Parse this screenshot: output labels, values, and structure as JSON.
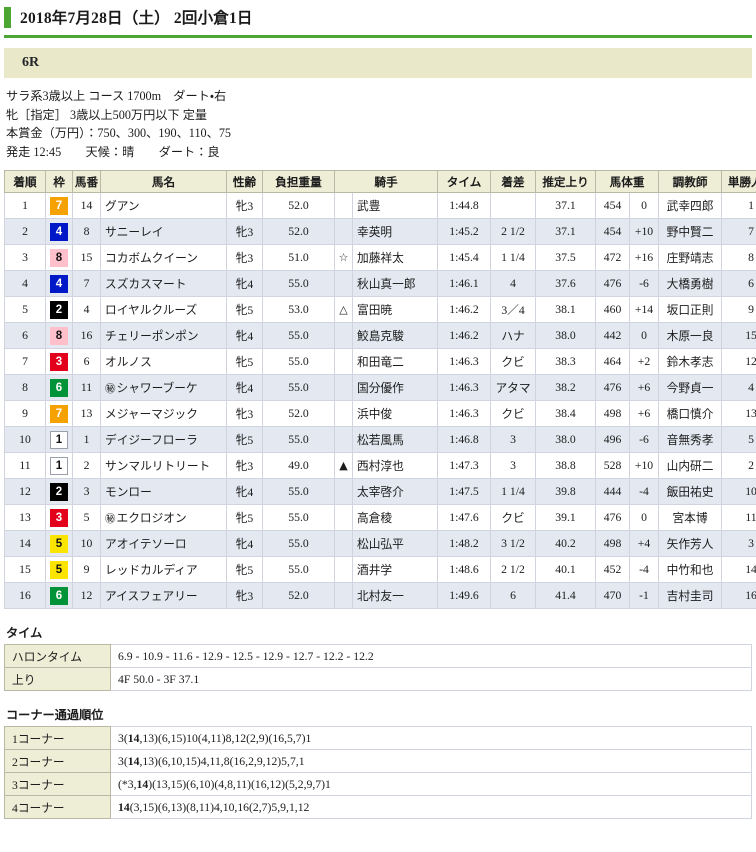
{
  "header": {
    "date_title": "2018年7月28日（土） 2回小倉1日",
    "accent_color": "#4ca632"
  },
  "race": {
    "number_label": "6R",
    "banner_color": "#e9e8c8",
    "conditions": [
      "サラ系3歳以上 コース 1700m　ダート・右",
      "牝［指定］ 3歳以上500万円以下 定量",
      "本賞金（万円）：750、300、190、110、75",
      "発走 12:45　　天候：晴　　ダート：良"
    ]
  },
  "result_table": {
    "columns": [
      "着順",
      "枠",
      "馬番",
      "馬名",
      "性齢",
      "負担重量",
      "騎手",
      "タイム",
      "着差",
      "推定上り",
      "馬体重",
      "調教師",
      "単勝人気"
    ],
    "rows": [
      {
        "rank": "1",
        "waku": "7",
        "umaban": "14",
        "local_mark": "",
        "horse": "グアン",
        "sex_age": "牝3",
        "weight": "52.0",
        "jockey_mark": "",
        "jockey": "武豊",
        "time": "1:44.8",
        "margin": "",
        "last3f": "37.1",
        "body_weight": "454",
        "body_diff": "0",
        "trainer": "武幸四郎",
        "popularity": "1"
      },
      {
        "rank": "2",
        "waku": "4",
        "umaban": "8",
        "local_mark": "",
        "horse": "サニーレイ",
        "sex_age": "牝3",
        "weight": "52.0",
        "jockey_mark": "",
        "jockey": "幸英明",
        "time": "1:45.2",
        "margin": "2 1/2",
        "last3f": "37.1",
        "body_weight": "454",
        "body_diff": "+10",
        "trainer": "野中賢二",
        "popularity": "7"
      },
      {
        "rank": "3",
        "waku": "8",
        "umaban": "15",
        "local_mark": "",
        "horse": "コカボムクイーン",
        "sex_age": "牝3",
        "weight": "51.0",
        "jockey_mark": "☆",
        "jockey": "加藤祥太",
        "time": "1:45.4",
        "margin": "1 1/4",
        "last3f": "37.5",
        "body_weight": "472",
        "body_diff": "+16",
        "trainer": "庄野靖志",
        "popularity": "8"
      },
      {
        "rank": "4",
        "waku": "4",
        "umaban": "7",
        "local_mark": "",
        "horse": "スズカスマート",
        "sex_age": "牝4",
        "weight": "55.0",
        "jockey_mark": "",
        "jockey": "秋山真一郎",
        "time": "1:46.1",
        "margin": "4",
        "last3f": "37.6",
        "body_weight": "476",
        "body_diff": "-6",
        "trainer": "大橋勇樹",
        "popularity": "6"
      },
      {
        "rank": "5",
        "waku": "2",
        "umaban": "4",
        "local_mark": "",
        "horse": "ロイヤルクルーズ",
        "sex_age": "牝5",
        "weight": "53.0",
        "jockey_mark": "△",
        "jockey": "富田暁",
        "time": "1:46.2",
        "margin": "3／4",
        "last3f": "38.1",
        "body_weight": "460",
        "body_diff": "+14",
        "trainer": "坂口正則",
        "popularity": "9"
      },
      {
        "rank": "6",
        "waku": "8",
        "umaban": "16",
        "local_mark": "",
        "horse": "チェリーポンポン",
        "sex_age": "牝4",
        "weight": "55.0",
        "jockey_mark": "",
        "jockey": "鮫島克駿",
        "time": "1:46.2",
        "margin": "ハナ",
        "last3f": "38.0",
        "body_weight": "442",
        "body_diff": "0",
        "trainer": "木原一良",
        "popularity": "15"
      },
      {
        "rank": "7",
        "waku": "3",
        "umaban": "6",
        "local_mark": "",
        "horse": "オルノス",
        "sex_age": "牝5",
        "weight": "55.0",
        "jockey_mark": "",
        "jockey": "和田竜二",
        "time": "1:46.3",
        "margin": "クビ",
        "last3f": "38.3",
        "body_weight": "464",
        "body_diff": "+2",
        "trainer": "鈴木孝志",
        "popularity": "12"
      },
      {
        "rank": "8",
        "waku": "6",
        "umaban": "11",
        "local_mark": "地",
        "horse": "シャワーブーケ",
        "sex_age": "牝4",
        "weight": "55.0",
        "jockey_mark": "",
        "jockey": "国分優作",
        "time": "1:46.3",
        "margin": "アタマ",
        "last3f": "38.2",
        "body_weight": "476",
        "body_diff": "+6",
        "trainer": "今野貞一",
        "popularity": "4"
      },
      {
        "rank": "9",
        "waku": "7",
        "umaban": "13",
        "local_mark": "",
        "horse": "メジャーマジック",
        "sex_age": "牝3",
        "weight": "52.0",
        "jockey_mark": "",
        "jockey": "浜中俊",
        "time": "1:46.3",
        "margin": "クビ",
        "last3f": "38.4",
        "body_weight": "498",
        "body_diff": "+6",
        "trainer": "橋口慎介",
        "popularity": "13"
      },
      {
        "rank": "10",
        "waku": "1",
        "umaban": "1",
        "local_mark": "",
        "horse": "デイジーフローラ",
        "sex_age": "牝5",
        "weight": "55.0",
        "jockey_mark": "",
        "jockey": "松若風馬",
        "time": "1:46.8",
        "margin": "3",
        "last3f": "38.0",
        "body_weight": "496",
        "body_diff": "-6",
        "trainer": "音無秀孝",
        "popularity": "5"
      },
      {
        "rank": "11",
        "waku": "1",
        "umaban": "2",
        "local_mark": "",
        "horse": "サンマルリトリート",
        "sex_age": "牝3",
        "weight": "49.0",
        "jockey_mark": "▲",
        "jockey": "西村淳也",
        "time": "1:47.3",
        "margin": "3",
        "last3f": "38.8",
        "body_weight": "528",
        "body_diff": "+10",
        "trainer": "山内研二",
        "popularity": "2"
      },
      {
        "rank": "12",
        "waku": "2",
        "umaban": "3",
        "local_mark": "",
        "horse": "モンロー",
        "sex_age": "牝4",
        "weight": "55.0",
        "jockey_mark": "",
        "jockey": "太宰啓介",
        "time": "1:47.5",
        "margin": "1 1/4",
        "last3f": "39.8",
        "body_weight": "444",
        "body_diff": "-4",
        "trainer": "飯田祐史",
        "popularity": "10"
      },
      {
        "rank": "13",
        "waku": "3",
        "umaban": "5",
        "local_mark": "地",
        "horse": "エクロジオン",
        "sex_age": "牝5",
        "weight": "55.0",
        "jockey_mark": "",
        "jockey": "高倉稜",
        "time": "1:47.6",
        "margin": "クビ",
        "last3f": "39.1",
        "body_weight": "476",
        "body_diff": "0",
        "trainer": "宮本博",
        "popularity": "11"
      },
      {
        "rank": "14",
        "waku": "5",
        "umaban": "10",
        "local_mark": "",
        "horse": "アオイテソーロ",
        "sex_age": "牝4",
        "weight": "55.0",
        "jockey_mark": "",
        "jockey": "松山弘平",
        "time": "1:48.2",
        "margin": "3 1/2",
        "last3f": "40.2",
        "body_weight": "498",
        "body_diff": "+4",
        "trainer": "矢作芳人",
        "popularity": "3"
      },
      {
        "rank": "15",
        "waku": "5",
        "umaban": "9",
        "local_mark": "",
        "horse": "レッドカルディア",
        "sex_age": "牝5",
        "weight": "55.0",
        "jockey_mark": "",
        "jockey": "酒井学",
        "time": "1:48.6",
        "margin": "2 1/2",
        "last3f": "40.1",
        "body_weight": "452",
        "body_diff": "-4",
        "trainer": "中竹和也",
        "popularity": "14"
      },
      {
        "rank": "16",
        "waku": "6",
        "umaban": "12",
        "local_mark": "",
        "horse": "アイスフェアリー",
        "sex_age": "牝3",
        "weight": "52.0",
        "jockey_mark": "",
        "jockey": "北村友一",
        "time": "1:49.6",
        "margin": "6",
        "last3f": "41.4",
        "body_weight": "470",
        "body_diff": "-1",
        "trainer": "吉村圭司",
        "popularity": "16"
      }
    ]
  },
  "time_section": {
    "title": "タイム",
    "rows": [
      {
        "label": "ハロンタイム",
        "value": "6.9 - 10.9 - 11.6 - 12.9 - 12.5 - 12.9 - 12.7 - 12.2 - 12.2"
      },
      {
        "label": "上り",
        "value": "4F 50.0 - 3F 37.1"
      }
    ]
  },
  "corner_section": {
    "title": "コーナー通過順位",
    "rows": [
      {
        "label": "1コーナー",
        "pre": "3(",
        "bold": "14",
        "post": ",13)(6,15)10(4,11)8,12(2,9)(16,5,7)1"
      },
      {
        "label": "2コーナー",
        "pre": "3(",
        "bold": "14",
        "post": ",13)(6,10,15)4,11,8(16,2,9,12)5,7,1"
      },
      {
        "label": "3コーナー",
        "pre": "(*3,",
        "bold": "14",
        "post": ")(13,15)(6,10)(4,8,11)(16,12)(5,2,9,7)1"
      },
      {
        "label": "4コーナー",
        "pre": "",
        "bold": "14",
        "post": "(3,15)(6,13)(8,11)4,10,16(2,7)5,9,1,12"
      }
    ]
  }
}
